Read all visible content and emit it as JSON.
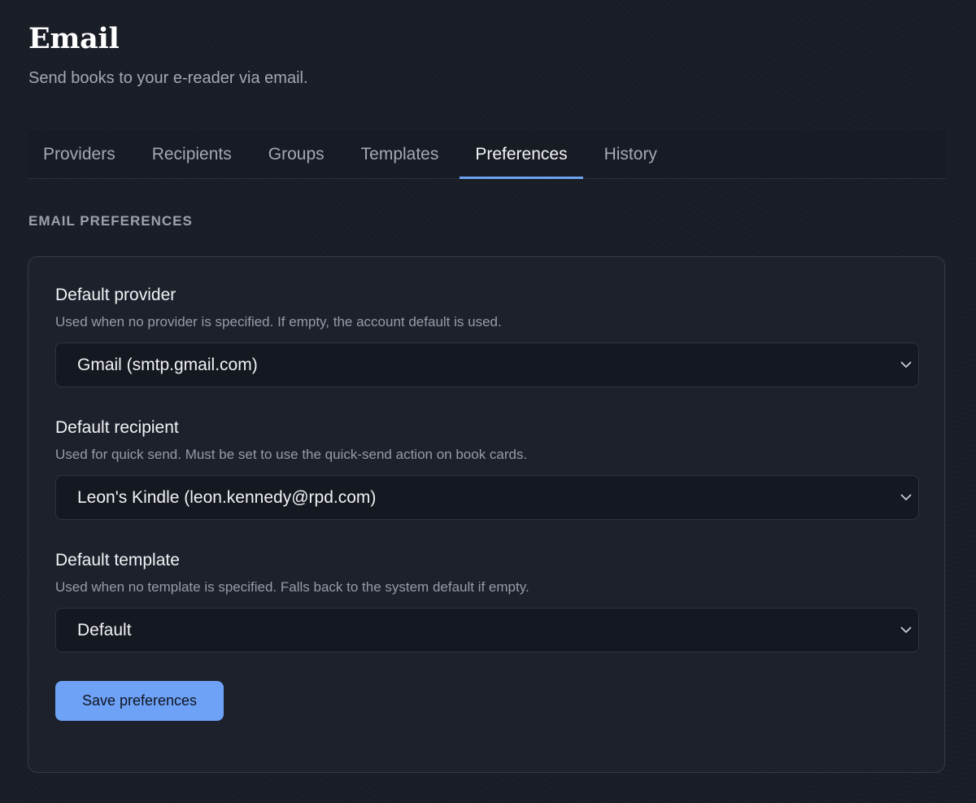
{
  "header": {
    "title": "Email",
    "subtitle": "Send books to your e-reader via email."
  },
  "tabs": [
    {
      "label": "Providers",
      "active": false
    },
    {
      "label": "Recipients",
      "active": false
    },
    {
      "label": "Groups",
      "active": false
    },
    {
      "label": "Templates",
      "active": false
    },
    {
      "label": "Preferences",
      "active": true
    },
    {
      "label": "History",
      "active": false
    }
  ],
  "section": {
    "heading": "EMAIL PREFERENCES"
  },
  "preferences": {
    "provider": {
      "label": "Default provider",
      "help": "Used when no provider is specified. If empty, the account default is used.",
      "value": "Gmail (smtp.gmail.com)"
    },
    "recipient": {
      "label": "Default recipient",
      "help": "Used for quick send. Must be set to use the quick-send action on book cards.",
      "value": "Leon's Kindle (leon.kennedy@rpd.com)"
    },
    "template": {
      "label": "Default template",
      "help": "Used when no template is specified. Falls back to the system default if empty.",
      "value": "Default"
    },
    "save_label": "Save preferences"
  },
  "icons": {
    "select_arrow": "chevron-down-icon"
  },
  "colors": {
    "accent": "#6ea2f7",
    "background": "#191d26",
    "card": "#1c212b"
  }
}
